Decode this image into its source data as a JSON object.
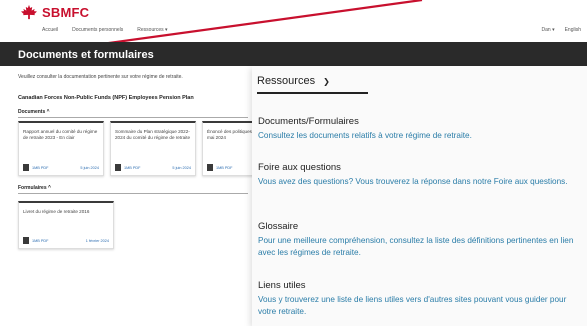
{
  "brand": {
    "name": "SBMFC",
    "color": "#c8102e",
    "icon": "maple-leaf-icon"
  },
  "topnav": [
    "Accueil",
    "Documents personnels",
    "Ressources ▾"
  ],
  "topright": {
    "user": "Dan ▾",
    "language": "English"
  },
  "header": {
    "title": "Documents et formulaires"
  },
  "main": {
    "intro": "Veuillez consulter la documentation pertinente sur votre régime de retraite.",
    "plan": "Canadian Forces Non-Public Funds (NPF) Employees Pension Plan",
    "documents": {
      "heading": "Documents ^",
      "cards": [
        {
          "title": "Rapport annuel du comité du régime de retraite 2023 - En clair",
          "size": "1MB PDF",
          "date": "5 juin 2024"
        },
        {
          "title": "Sommaire du Plan stratégique 2022-2024 du comité du régime de retraite",
          "size": "1MB PDF",
          "date": "5 juin 2024"
        },
        {
          "title": "Énoncé des politiques et procédures mai 2024",
          "size": "1MB PDF",
          "date": "5 juin 2024"
        }
      ]
    },
    "forms": {
      "heading": "Formulaires ^",
      "cards": [
        {
          "title": "Livret du régime de retraite 2016",
          "size": "1MB PDF",
          "date": "1 février 2024"
        }
      ]
    }
  },
  "dropdown": {
    "label": "Ressources",
    "items": [
      {
        "title": "Documents/Formulaires",
        "desc": "Consultez les documents relatifs à votre régime de retraite."
      },
      {
        "title": "Foire aux questions",
        "desc": "Vous avez des questions? Vous trouverez la réponse dans notre Foire aux questions."
      },
      {
        "title": "Glossaire",
        "desc": "Pour une meilleure compréhension, consultez la liste des définitions pertinentes en lien avec les régimes de retraite."
      },
      {
        "title": "Liens utiles",
        "desc": "Vous y trouverez une liste de liens utiles vers d'autres sites pouvant vous guider pour votre retraite."
      }
    ]
  },
  "colors": {
    "accent": "#c8102e",
    "header_band": "#2a2a2a",
    "link": "#2b7da8"
  }
}
